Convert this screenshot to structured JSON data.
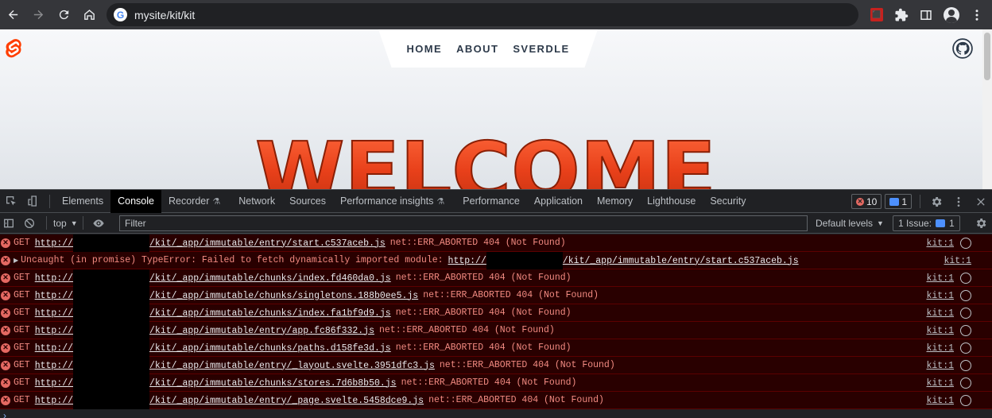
{
  "browser": {
    "url": "mysite/kit/kit"
  },
  "site": {
    "nav": [
      "HOME",
      "ABOUT",
      "SVERDLE"
    ],
    "hero_text": "WELCOME"
  },
  "devtools": {
    "tabs": [
      "Elements",
      "Console",
      "Recorder",
      "Network",
      "Sources",
      "Performance insights",
      "Performance",
      "Application",
      "Memory",
      "Lighthouse",
      "Security"
    ],
    "active_tab": "Console",
    "error_count": "10",
    "message_count": "1",
    "context": "top",
    "filter_placeholder": "Filter",
    "levels": "Default levels",
    "issues_label": "1 Issue:",
    "issues_count": "1"
  },
  "console": {
    "rows": [
      {
        "prefix": "GET",
        "link_start": "http://",
        "link_end": "/kit/_app/immutable/entry/start.c537aceb.js",
        "message": "net::ERR_ABORTED 404 (Not Found)",
        "source": "kit:1"
      },
      {
        "prefix": "Uncaught (in promise) TypeError: Failed to fetch dynamically imported module:",
        "link_start": "http://",
        "link_end": "/kit/_app/immutable/entry/start.c537aceb.js",
        "message": "",
        "source": "kit:1"
      },
      {
        "prefix": "GET",
        "link_start": "http://",
        "link_end": "/kit/_app/immutable/chunks/index.fd460da0.js",
        "message": "net::ERR_ABORTED 404 (Not Found)",
        "source": "kit:1"
      },
      {
        "prefix": "GET",
        "link_start": "http://",
        "link_end": "/kit/_app/immutable/chunks/singletons.188b0ee5.js",
        "message": "net::ERR_ABORTED 404 (Not Found)",
        "source": "kit:1"
      },
      {
        "prefix": "GET",
        "link_start": "http://",
        "link_end": "/kit/_app/immutable/chunks/index.fa1bf9d9.js",
        "message": "net::ERR_ABORTED 404 (Not Found)",
        "source": "kit:1"
      },
      {
        "prefix": "GET",
        "link_start": "http://",
        "link_end": "/kit/_app/immutable/entry/app.fc86f332.js",
        "message": "net::ERR_ABORTED 404 (Not Found)",
        "source": "kit:1"
      },
      {
        "prefix": "GET",
        "link_start": "http://",
        "link_end": "/kit/_app/immutable/chunks/paths.d158fe3d.js",
        "message": "net::ERR_ABORTED 404 (Not Found)",
        "source": "kit:1"
      },
      {
        "prefix": "GET",
        "link_start": "http://",
        "link_end": "/kit/_app/immutable/entry/_layout.svelte.3951dfc3.js",
        "message": "net::ERR_ABORTED 404 (Not Found)",
        "source": "kit:1"
      },
      {
        "prefix": "GET",
        "link_start": "http://",
        "link_end": "/kit/_app/immutable/chunks/stores.7d6b8b50.js",
        "message": "net::ERR_ABORTED 404 (Not Found)",
        "source": "kit:1"
      },
      {
        "prefix": "GET",
        "link_start": "http://",
        "link_end": "/kit/_app/immutable/entry/_page.svelte.5458dce9.js",
        "message": "net::ERR_ABORTED 404 (Not Found)",
        "source": "kit:1"
      }
    ],
    "prompt": "›"
  }
}
